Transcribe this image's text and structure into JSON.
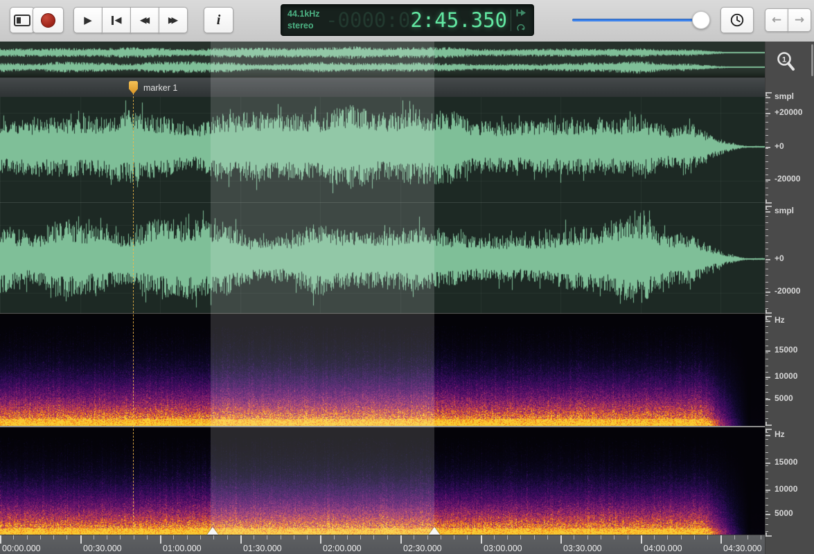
{
  "toolbar": {
    "time_display": {
      "sample_rate": "44.1kHz",
      "channel_mode": "stereo",
      "ghost_digits": "-0000:0",
      "current_time": "2:45.350"
    }
  },
  "icons": {
    "play": "▶",
    "skip_back_triangle": "◀",
    "rewind": "◀◀",
    "fast_forward": "▶▶",
    "info": "i",
    "nav_back": "←",
    "nav_forward": "→",
    "zoom_level": "1"
  },
  "marker": {
    "label": "marker 1"
  },
  "scales": {
    "waveform_left": {
      "ticks": [
        "smpl",
        "+20000",
        "+0",
        "-20000"
      ]
    },
    "waveform_right": {
      "ticks": [
        "smpl",
        "+0",
        "-20000"
      ]
    },
    "spectrogram_left": {
      "ticks": [
        "Hz",
        "15000",
        "10000",
        "5000"
      ]
    },
    "spectrogram_right": {
      "ticks": [
        "Hz",
        "15000",
        "10000",
        "5000"
      ]
    }
  },
  "ruler": {
    "labels": [
      "00:00.000",
      "00:30.000",
      "01:00.000",
      "01:30.000",
      "02:00.000",
      "02:30.000",
      "03:00.000",
      "03:30.000",
      "04:00.000",
      "04:30.000"
    ]
  },
  "colors": {
    "waveform": "#7fbf98",
    "waveform_background": "#1d2924",
    "overview_background": "#27322c",
    "selection_overlay": "rgba(255,255,255,0.15)",
    "marker": "#e9a93e",
    "time_text": "#62e8a2",
    "slider_accent": "#3d84ee",
    "spectrogram_hot": "#f9cb35"
  }
}
